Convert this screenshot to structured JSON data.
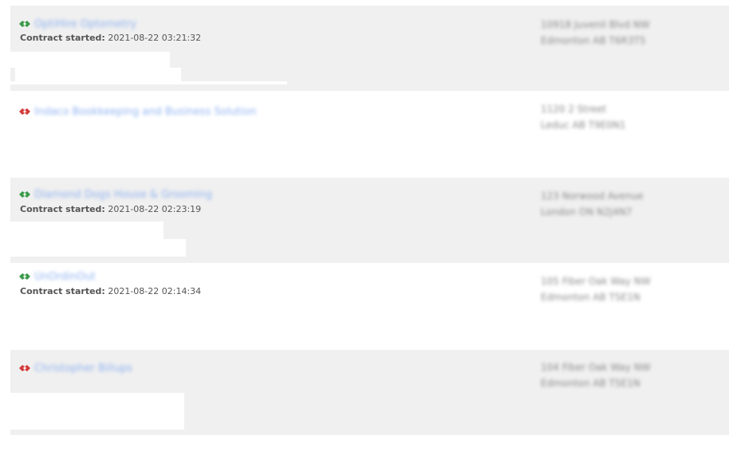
{
  "rows": [
    {
      "name": "OptiHire Optometry",
      "contract_label": "Contract started:",
      "contract_value": "2021-08-22 03:21:32",
      "address_line1": "10918 Juvenil Blvd NW",
      "address_line2": "Edmonton AB T6R3T5",
      "status_icon": "handshake-green-icon"
    },
    {
      "name": "Indaco Bookkeeping and Business Solution",
      "contract_label": "",
      "contract_value": "",
      "address_line1": "1120 2 Street",
      "address_line2": "Leduc AB T9E0N1",
      "status_icon": "handshake-red-icon"
    },
    {
      "name": "Diamond Dogs House & Grooming",
      "contract_label": "Contract started:",
      "contract_value": "2021-08-22 02:23:19",
      "address_line1": "123 Norwood Avenue",
      "address_line2": "London ON N2J4N7",
      "status_icon": "handshake-green-icon"
    },
    {
      "name": "UnOrdinOut",
      "contract_label": "Contract started:",
      "contract_value": "2021-08-22 02:14:34",
      "address_line1": "105 Fiber Oak Way NW",
      "address_line2": "Edmonton AB T5E1N",
      "status_icon": "handshake-green-icon"
    },
    {
      "name": "Christopher Billups",
      "contract_label": "",
      "contract_value": "",
      "address_line1": "104 Fiber Oak Way NW",
      "address_line2": "Edmonton AB T5E1N",
      "status_icon": "handshake-red-icon"
    }
  ],
  "colors": {
    "link": "#8fb2f0",
    "shaded_row": "#f0f0f0",
    "status_ok": "#3a9a4a",
    "status_ended": "#d43a3a"
  }
}
